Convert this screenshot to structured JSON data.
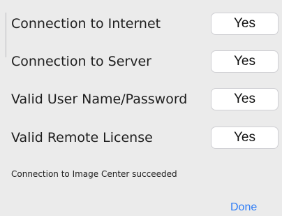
{
  "rows": [
    {
      "label": "Connection to Internet",
      "value": "Yes"
    },
    {
      "label": "Connection to Server",
      "value": "Yes"
    },
    {
      "label": "Valid User Name/Password",
      "value": "Yes"
    },
    {
      "label": "Valid Remote License",
      "value": "Yes"
    }
  ],
  "status_message": "Connection to Image Center succeeded",
  "done_label": "Done",
  "colors": {
    "background": "#ebebeb",
    "text": "#1e1e1e",
    "accent": "#2f7df6"
  }
}
